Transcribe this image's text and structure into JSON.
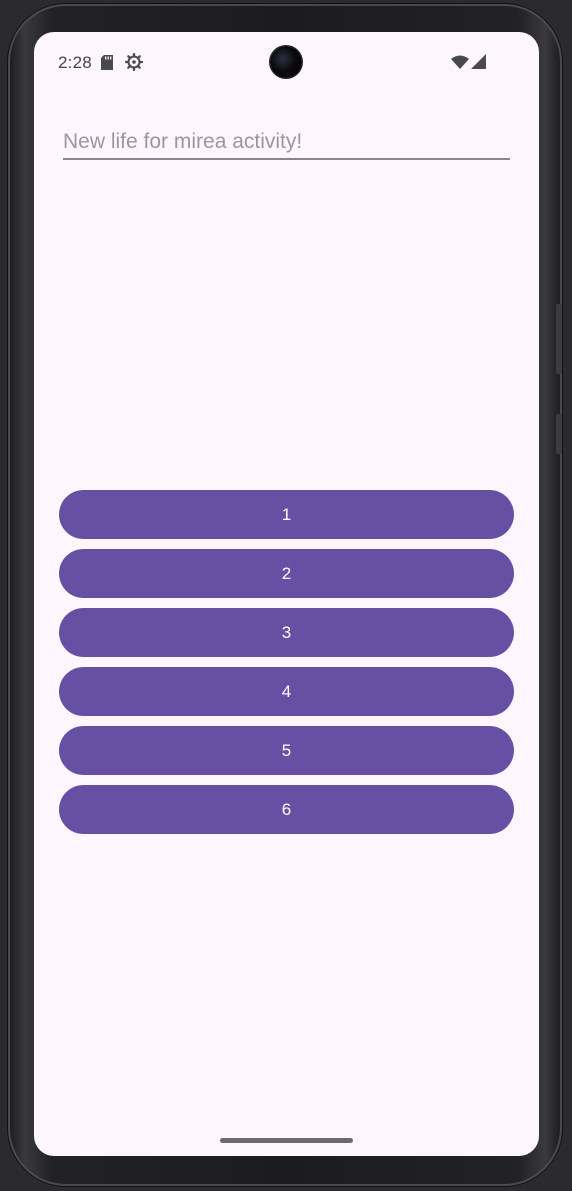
{
  "status_bar": {
    "time": "2:28",
    "icons": [
      "sd-card-icon",
      "settings-gear-icon",
      "wifi-icon",
      "cell-signal-icon"
    ]
  },
  "edit_text": {
    "placeholder": "New life for mirea activity!",
    "value": ""
  },
  "buttons": [
    {
      "label": "1"
    },
    {
      "label": "2"
    },
    {
      "label": "3"
    },
    {
      "label": "4"
    },
    {
      "label": "5"
    },
    {
      "label": "6"
    }
  ],
  "colors": {
    "background": "#fdf6fd",
    "button": "#6750a4",
    "button_text": "#ffffff",
    "underline": "#8a848d"
  }
}
